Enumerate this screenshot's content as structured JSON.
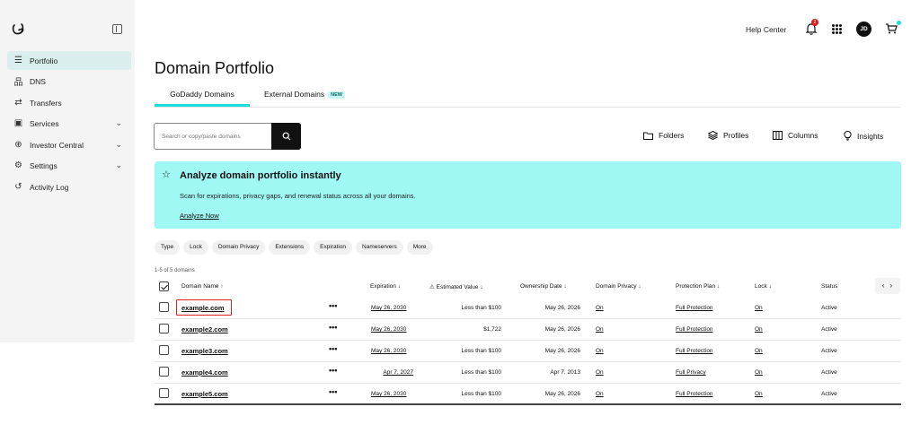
{
  "header": {
    "help_center": "Help Center",
    "notification_count": "2",
    "avatar_initials": "JD"
  },
  "sidebar": {
    "items": [
      {
        "label": "Portfolio",
        "icon": "list-icon",
        "active": true
      },
      {
        "label": "DNS",
        "icon": "network-icon"
      },
      {
        "label": "Transfers",
        "icon": "transfer-icon"
      },
      {
        "label": "Services",
        "icon": "briefcase-icon",
        "expandable": true
      },
      {
        "label": "Investor Central",
        "icon": "globe-icon",
        "expandable": true
      },
      {
        "label": "Settings",
        "icon": "gear-icon",
        "expandable": true
      },
      {
        "label": "Activity Log",
        "icon": "history-icon"
      }
    ]
  },
  "main": {
    "title": "Domain Portfolio",
    "tabs": [
      {
        "label": "GoDaddy Domains",
        "active": true
      },
      {
        "label": "External Domains",
        "badge": "NEW"
      }
    ],
    "search_placeholder": "Search or copy/paste domains",
    "toolbar": {
      "folders": "Folders",
      "profiles": "Profiles",
      "columns": "Columns",
      "insights": "Insights"
    },
    "banner": {
      "title": "Analyze domain portfolio instantly",
      "text": "Scan for expirations, privacy gaps, and renewal status across all your domains.",
      "link": "Analyze Now"
    },
    "filters": [
      "Type",
      "Lock",
      "Domain Privacy",
      "Extensions",
      "Expiration",
      "Nameservers",
      "More"
    ],
    "count": "1-5 of 5 domains",
    "columns": {
      "domain": "Domain Name",
      "expiration": "Expiration",
      "value": "Estimated Value",
      "ownership": "Ownership Date",
      "privacy": "Domain Privacy",
      "protection": "Protection Plan",
      "lock": "Lock",
      "status": "Status"
    },
    "more_label": "•••",
    "rows": [
      {
        "domain": "example.com",
        "expiration": "May 26, 2030",
        "value": "Less than $100",
        "ownership": "May 26, 2026",
        "privacy": "On",
        "protection": "Full Protection",
        "lock": "On",
        "status": "Active"
      },
      {
        "domain": "example2.com",
        "expiration": "May 26, 2030",
        "value": "$1,722",
        "ownership": "May 26, 2026",
        "privacy": "On",
        "protection": "Full Protection",
        "lock": "On",
        "status": "Active"
      },
      {
        "domain": "example3.com",
        "expiration": "May 26, 2030",
        "value": "Less than $100",
        "ownership": "May 26, 2026",
        "privacy": "On",
        "protection": "Full Protection",
        "lock": "On",
        "status": "Active"
      },
      {
        "domain": "example4.com",
        "expiration": "Apr 7, 2027",
        "value": "Less than $100",
        "ownership": "Apr 7, 2013",
        "privacy": "On",
        "protection": "Full Privacy",
        "lock": "On",
        "status": "Active"
      },
      {
        "domain": "example5.com",
        "expiration": "May 26, 2030",
        "value": "Less than $100",
        "ownership": "May 26, 2026",
        "privacy": "On",
        "protection": "Full Protection",
        "lock": "On",
        "status": "Active"
      }
    ]
  },
  "colors": {
    "accent": "#1bdbdb",
    "banner_bg": "#a0f8f4",
    "sidebar_bg": "#f4f4f4",
    "highlight_box": "#e02020"
  }
}
